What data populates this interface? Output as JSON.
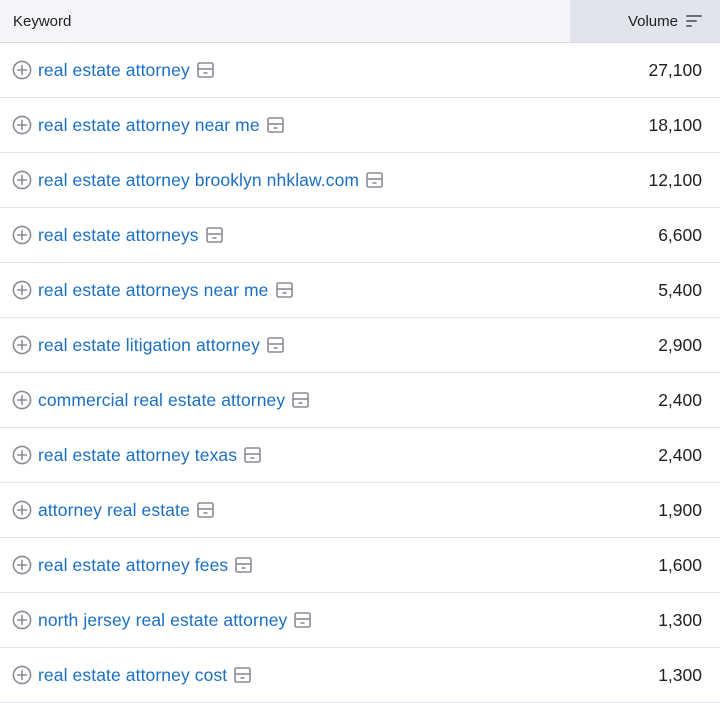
{
  "header": {
    "keyword_label": "Keyword",
    "volume_label": "Volume",
    "sort_icon": "sort-descending-icon"
  },
  "rows": [
    {
      "keyword": "real estate attorney",
      "volume": "27,100"
    },
    {
      "keyword": "real estate attorney near me",
      "volume": "18,100"
    },
    {
      "keyword": "real estate attorney brooklyn nhklaw.com",
      "volume": "12,100"
    },
    {
      "keyword": "real estate attorneys",
      "volume": "6,600"
    },
    {
      "keyword": "real estate attorneys near me",
      "volume": "5,400"
    },
    {
      "keyword": "real estate litigation attorney",
      "volume": "2,900"
    },
    {
      "keyword": "commercial real estate attorney",
      "volume": "2,400"
    },
    {
      "keyword": "real estate attorney texas",
      "volume": "2,400"
    },
    {
      "keyword": "attorney real estate",
      "volume": "1,900"
    },
    {
      "keyword": "real estate attorney fees",
      "volume": "1,600"
    },
    {
      "keyword": "north jersey real estate attorney",
      "volume": "1,300"
    },
    {
      "keyword": "real estate attorney cost",
      "volume": "1,300"
    }
  ],
  "icons": {
    "add": "plus-circle-icon",
    "serp": "serp-features-icon"
  },
  "colors": {
    "link": "#1a6fc4",
    "header_bg": "#f4f5f9",
    "sorted_col_bg": "#e2e4ec",
    "icon_gray": "#8a8c96"
  }
}
